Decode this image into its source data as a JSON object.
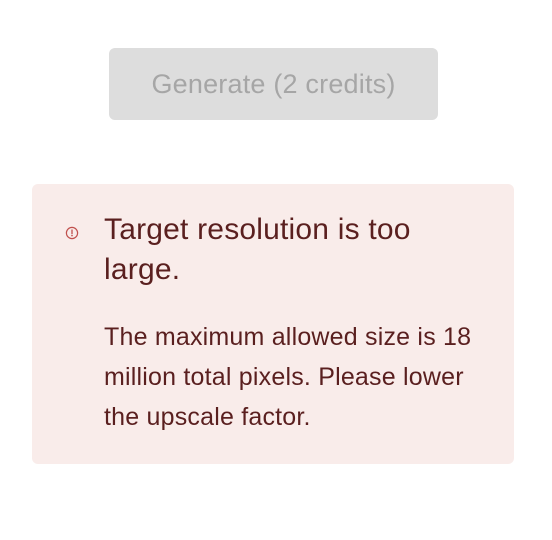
{
  "generate_button": {
    "label": "Generate (2 credits)"
  },
  "error_alert": {
    "icon": "alert-circle-icon",
    "title": "Target resolution is too large.",
    "message": "The maximum allowed size is 18 million total pixels. Please lower the upscale factor."
  },
  "colors": {
    "button_bg": "#dddddd",
    "button_text": "#a6a6a6",
    "alert_bg": "#f9ecea",
    "alert_text": "#5a1f1f",
    "alert_icon": "#c0504d"
  }
}
